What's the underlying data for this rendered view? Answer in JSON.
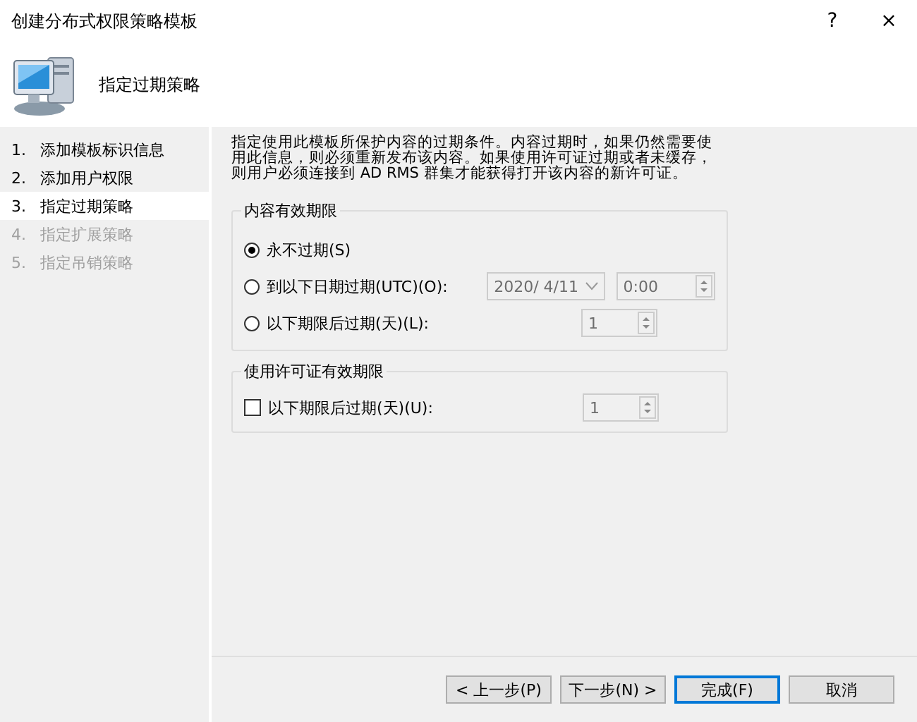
{
  "window": {
    "title": "创建分布式权限策略模板",
    "help": "?",
    "close": "×"
  },
  "header": {
    "title": "指定过期策略"
  },
  "steps": [
    {
      "number": "1.",
      "label": "添加模板标识信息",
      "selected": false,
      "disabled": false
    },
    {
      "number": "2.",
      "label": "添加用户权限",
      "selected": false,
      "disabled": false
    },
    {
      "number": "3.",
      "label": "指定过期策略",
      "selected": true,
      "disabled": false
    },
    {
      "number": "4.",
      "label": "指定扩展策略",
      "selected": false,
      "disabled": true
    },
    {
      "number": "5.",
      "label": "指定吊销策略",
      "selected": false,
      "disabled": true
    }
  ],
  "description": "指定使用此模板所保护内容的过期条件。内容过期时，如果仍然需要使用此信息，则必须重新发布该内容。如果使用许可证过期或者未缓存，则用户必须连接到 AD RMS 群集才能获得打开该内容的新许可证。",
  "content_expiration": {
    "title": "内容有效期限",
    "options": [
      {
        "kind": "plain",
        "label": "永不过期(S)",
        "selected": true
      },
      {
        "kind": "date",
        "label": "到以下日期过期(UTC)(O):",
        "selected": false,
        "date": "2020/ 4/11",
        "time": "0:00",
        "disabled": true
      },
      {
        "kind": "days",
        "label": "以下期限后过期(天)(L):",
        "selected": false,
        "value": "1",
        "disabled": true
      }
    ]
  },
  "license_expiration": {
    "title": "使用许可证有效期限",
    "label": "以下期限后过期(天)(U):",
    "checked": false,
    "value": "1",
    "disabled": true
  },
  "buttons": [
    {
      "label": "< 上一步(P)",
      "default": false
    },
    {
      "label": "下一步(N) >",
      "default": false
    },
    {
      "label": "完成(F)",
      "default": true
    },
    {
      "label": "取消",
      "default": false
    }
  ]
}
